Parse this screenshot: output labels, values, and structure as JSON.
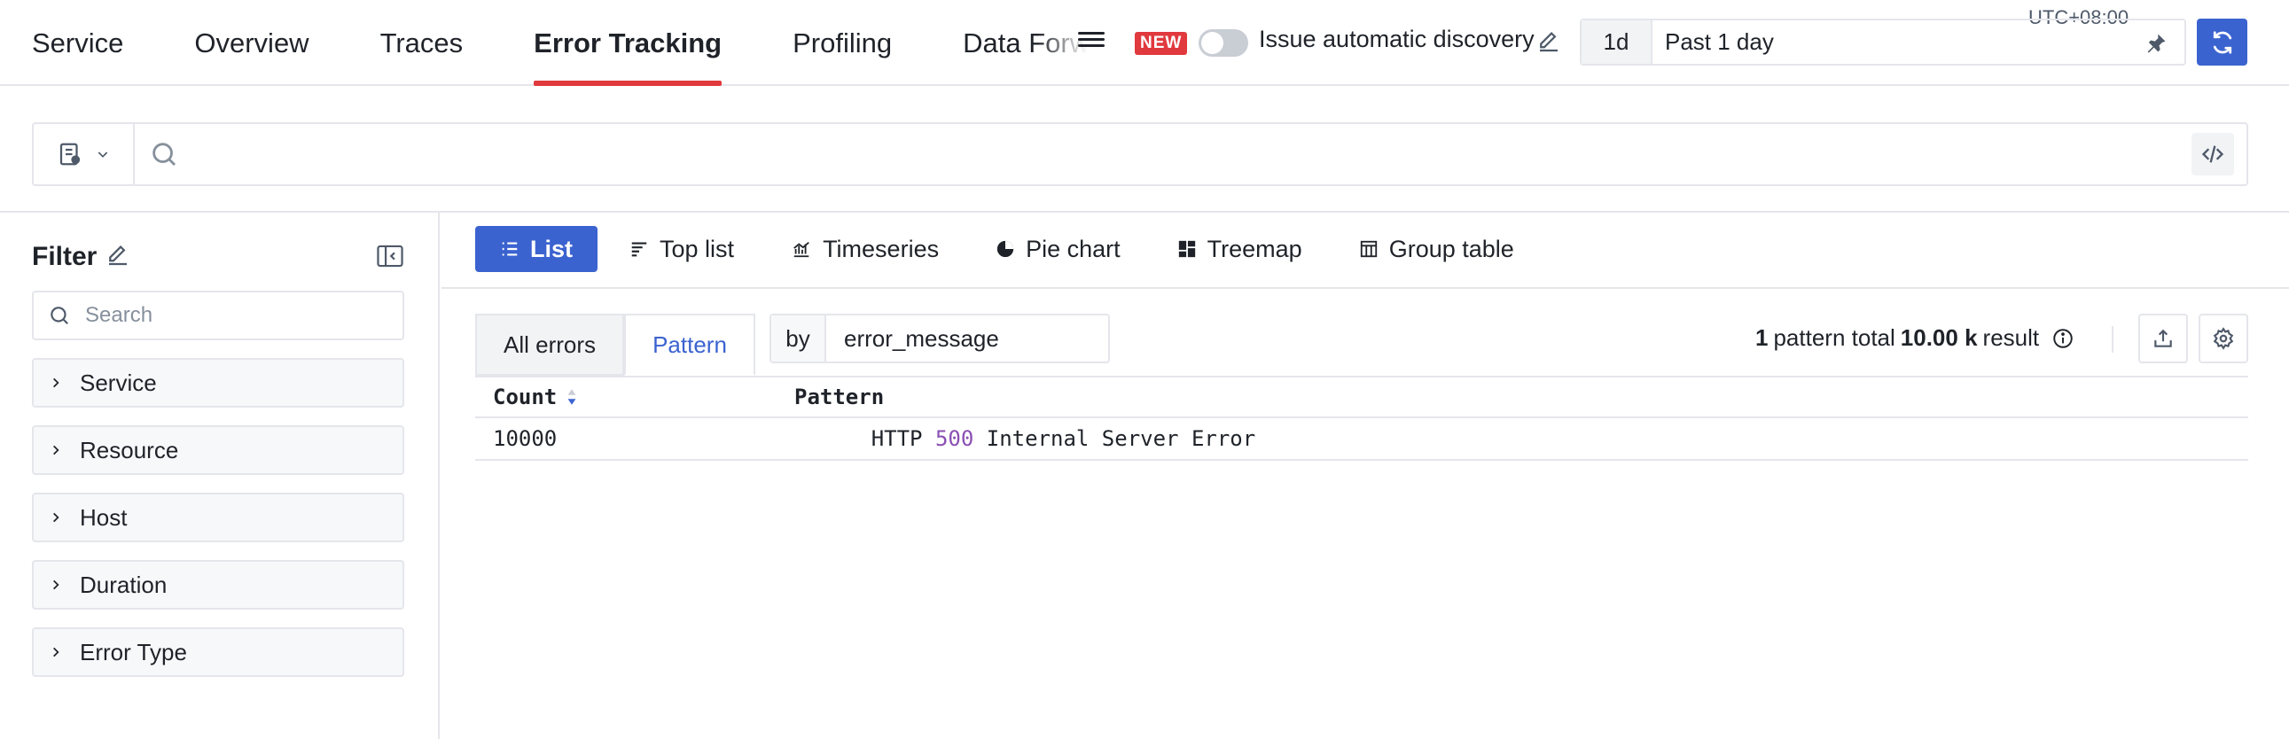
{
  "nav": {
    "tabs": [
      {
        "label": "Service"
      },
      {
        "label": "Overview"
      },
      {
        "label": "Traces"
      },
      {
        "label": "Error Tracking",
        "active": true
      },
      {
        "label": "Profiling"
      },
      {
        "label": "Data Forw"
      }
    ],
    "new_badge": "NEW",
    "discovery_label": "Issue automatic discovery",
    "discovery_enabled": false
  },
  "time": {
    "short": "1d",
    "long": "Past 1 day",
    "timezone": "UTC+08:00"
  },
  "search": {
    "placeholder": ""
  },
  "filter": {
    "title": "Filter",
    "search_placeholder": "Search",
    "facets": [
      "Service",
      "Resource",
      "Host",
      "Duration",
      "Error Type"
    ]
  },
  "views": {
    "tabs": [
      {
        "label": "List",
        "icon": "list-icon",
        "active": true
      },
      {
        "label": "Top list",
        "icon": "toplist-icon"
      },
      {
        "label": "Timeseries",
        "icon": "timeseries-icon"
      },
      {
        "label": "Pie chart",
        "icon": "pie-chart-icon"
      },
      {
        "label": "Treemap",
        "icon": "treemap-icon"
      },
      {
        "label": "Group table",
        "icon": "group-table-icon"
      }
    ]
  },
  "mode": {
    "all_errors": "All errors",
    "pattern": "Pattern",
    "by_label": "by",
    "by_value": "error_message"
  },
  "summary": {
    "count": "1",
    "text1": "pattern total",
    "total": "10.00 k",
    "text2": "result"
  },
  "table": {
    "headers": {
      "count": "Count",
      "pattern": "Pattern"
    },
    "rows": [
      {
        "count": "10000",
        "pattern_prefix": "HTTP ",
        "pattern_number": "500",
        "pattern_suffix": " Internal Server Error"
      }
    ]
  },
  "colors": {
    "accent": "#3b63d0",
    "active_underline": "#e0393e",
    "number_token": "#8a4fb3"
  }
}
